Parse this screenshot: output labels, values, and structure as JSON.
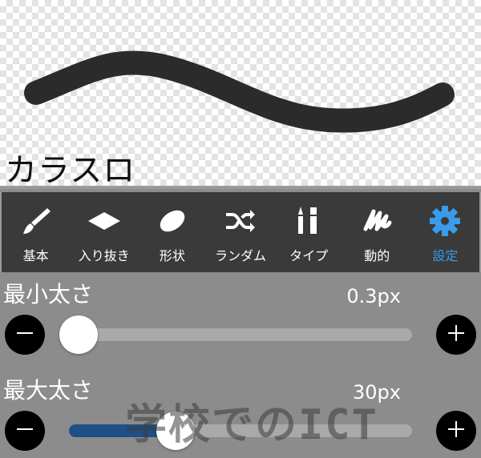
{
  "preview": {
    "brush_name": "カラスロ"
  },
  "tabs": [
    {
      "label": "基本",
      "icon": "brush-icon",
      "active": false
    },
    {
      "label": "入り抜き",
      "icon": "diamond-icon",
      "active": false
    },
    {
      "label": "形状",
      "icon": "ellipse-icon",
      "active": false
    },
    {
      "label": "ランダム",
      "icon": "shuffle-icon",
      "active": false
    },
    {
      "label": "タイプ",
      "icon": "brush-tips-icon",
      "active": false
    },
    {
      "label": "動的",
      "icon": "squiggle-icon",
      "active": false
    },
    {
      "label": "設定",
      "icon": "gear-icon",
      "active": true
    }
  ],
  "settings": {
    "min_size": {
      "label": "最小太さ",
      "value": "0.3px",
      "level": 0.0
    },
    "max_size": {
      "label": "最大太さ",
      "value": "30px",
      "level": 0.3
    }
  },
  "watermark": "学校でのICT",
  "colors": {
    "accent": "#3a9be8",
    "tabbar_bg": "#3a3a3a",
    "panel_bg": "#8c8c8c",
    "slider_fill": "#1e4f86",
    "stroke": "#2b2b2b"
  }
}
